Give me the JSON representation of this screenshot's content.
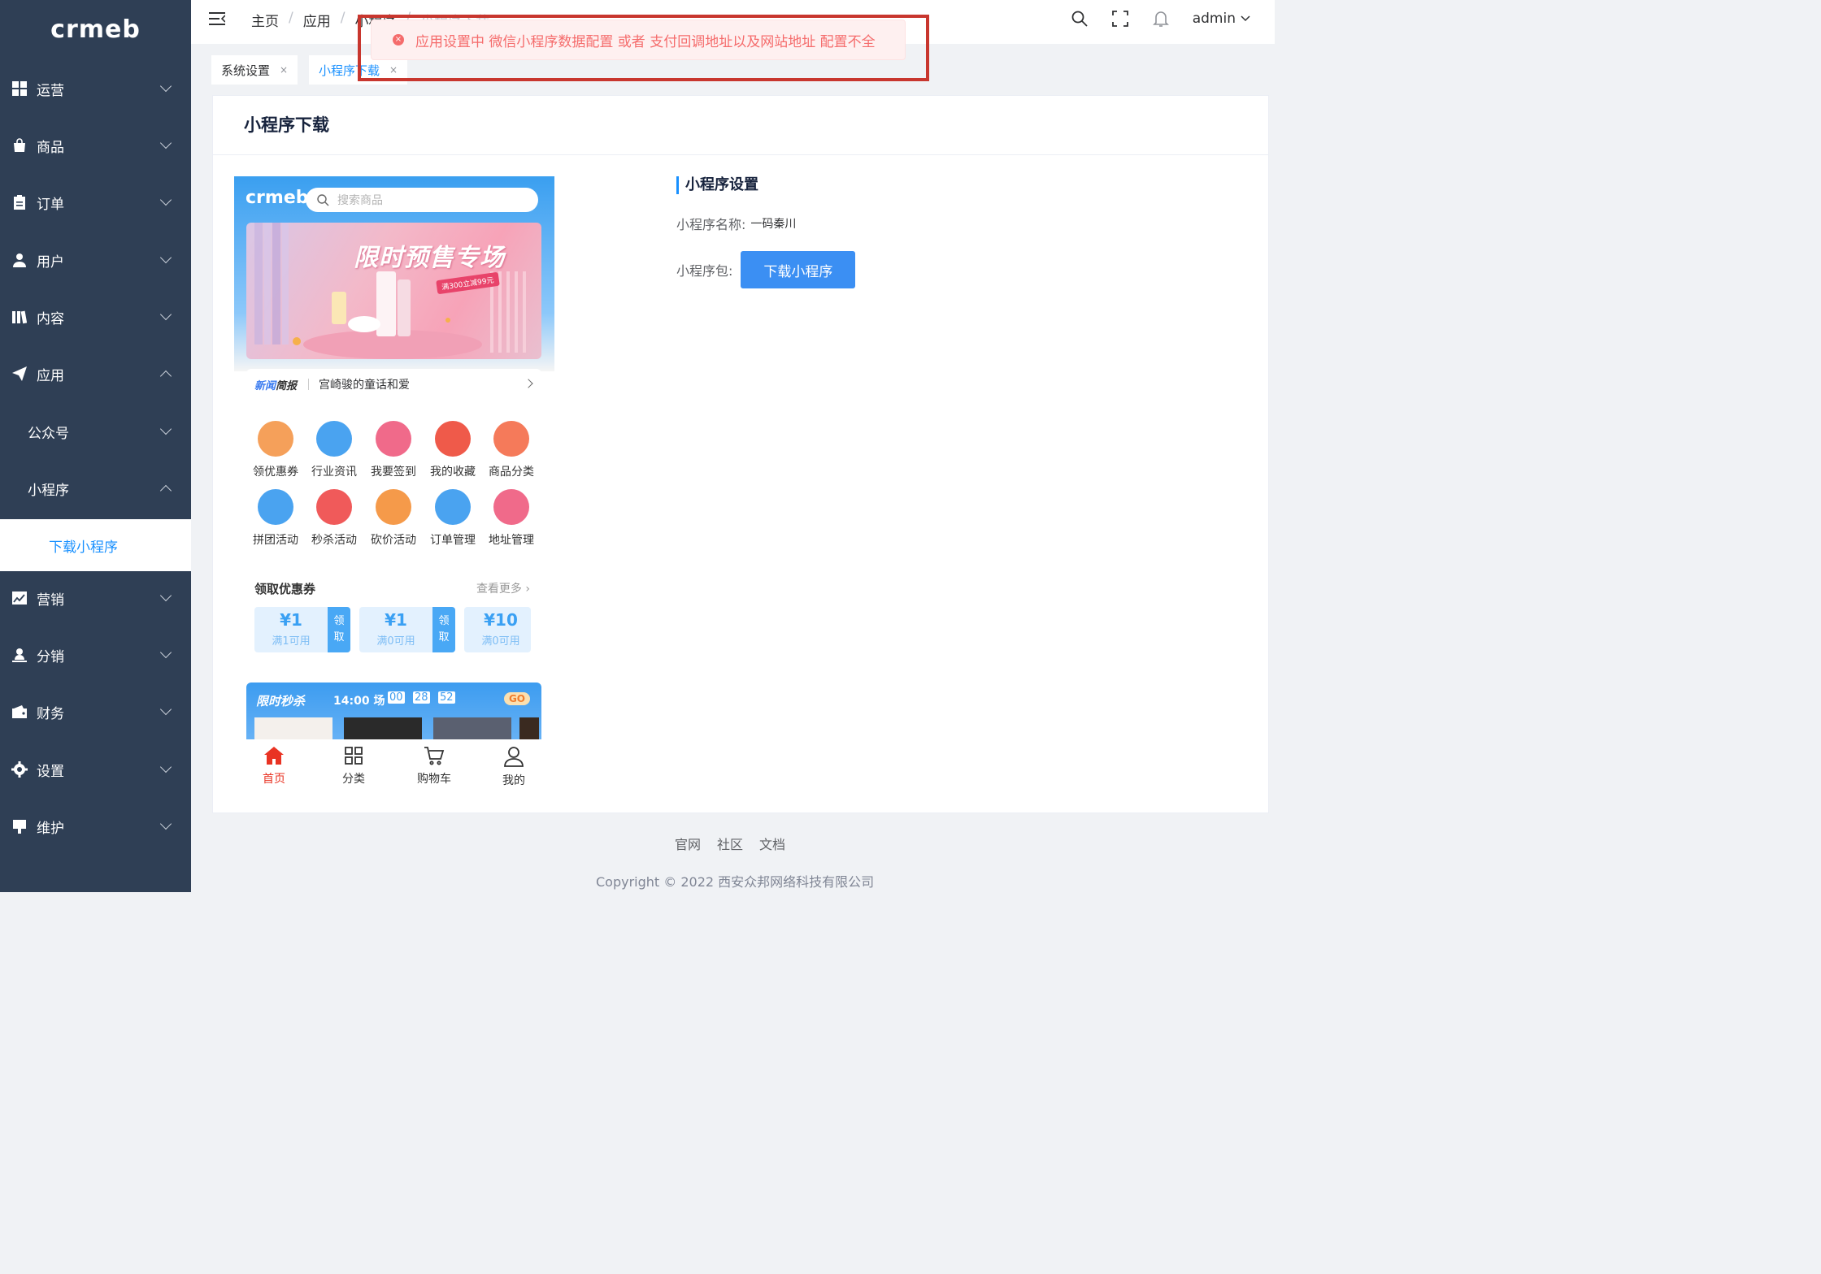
{
  "app": {
    "logo_text": "crmeb"
  },
  "sidebar": {
    "items": [
      {
        "label": "运营",
        "icon": "grid-icon"
      },
      {
        "label": "商品",
        "icon": "bag-icon"
      },
      {
        "label": "订单",
        "icon": "clipboard-icon"
      },
      {
        "label": "用户",
        "icon": "user-icon"
      },
      {
        "label": "内容",
        "icon": "library-icon"
      },
      {
        "label": "应用",
        "icon": "paper-plane-icon"
      },
      {
        "label": "公众号"
      },
      {
        "label": "小程序"
      },
      {
        "label": "下载小程序"
      },
      {
        "label": "营销",
        "icon": "chart-icon"
      },
      {
        "label": "分销",
        "icon": "user-stand-icon"
      },
      {
        "label": "财务",
        "icon": "wallet-icon"
      },
      {
        "label": "设置",
        "icon": "gear-icon"
      },
      {
        "label": "维护",
        "icon": "stamp-icon"
      }
    ]
  },
  "header": {
    "breadcrumb": [
      "主页",
      "应用",
      "小程序",
      "小程序下载"
    ],
    "user": "admin"
  },
  "tags": [
    {
      "label": "系统设置",
      "close": "×"
    },
    {
      "label": "小程序下载",
      "close": "×"
    }
  ],
  "toast": {
    "message": "应用设置中 微信小程序数据配置 或者 支付回调地址以及网站地址 配置不全"
  },
  "page": {
    "title": "小程序下载"
  },
  "preview": {
    "logo": "crmeb",
    "search_placeholder": "搜索商品",
    "banner_title": "限时预售专场",
    "banner_sub": "满300立减99元",
    "news_tag_a": "新闻",
    "news_tag_b": "简报",
    "news_text": "宫崎骏的童话和爱",
    "menu": [
      {
        "label": "领优惠券",
        "color": "#f5a05a"
      },
      {
        "label": "行业资讯",
        "color": "#4aa3f0"
      },
      {
        "label": "我要签到",
        "color": "#f06a8a"
      },
      {
        "label": "我的收藏",
        "color": "#ef5a4a"
      },
      {
        "label": "商品分类",
        "color": "#f57a5a"
      },
      {
        "label": "拼团活动",
        "color": "#4aa3f0"
      },
      {
        "label": "秒杀活动",
        "color": "#f05a5a"
      },
      {
        "label": "砍价活动",
        "color": "#f59a4a"
      },
      {
        "label": "订单管理",
        "color": "#4aa3f0"
      },
      {
        "label": "地址管理",
        "color": "#f06a8a"
      }
    ],
    "coupons_title": "领取优惠券",
    "coupons_more": "查看更多",
    "coupons": [
      {
        "amount": "1",
        "cond": "满1可用",
        "action_a": "领",
        "action_b": "取"
      },
      {
        "amount": "1",
        "cond": "满0可用",
        "action_a": "领",
        "action_b": "取"
      },
      {
        "amount": "10",
        "cond": "满0可用"
      }
    ],
    "seckill_title": "限时秒杀",
    "seckill_session": "14:00 场",
    "seckill_h": "00",
    "seckill_m": "28",
    "seckill_s": "52",
    "seckill_go": "GO",
    "tabbar": [
      {
        "label": "首页"
      },
      {
        "label": "分类"
      },
      {
        "label": "购物车"
      },
      {
        "label": "我的"
      }
    ]
  },
  "settings": {
    "title": "小程序设置",
    "name_label": "小程序名称:",
    "name_value": "一码秦川",
    "package_label": "小程序包:",
    "download_button": "下载小程序"
  },
  "footer": {
    "links": [
      "官网",
      "社区",
      "文档"
    ],
    "copyright": "Copyright © 2022 西安众邦网络科技有限公司"
  },
  "colors": {
    "sidebar_bg": "#2f3f55",
    "accent": "#1890ff",
    "error": "#f56c6c",
    "button": "#3b8ff3"
  }
}
